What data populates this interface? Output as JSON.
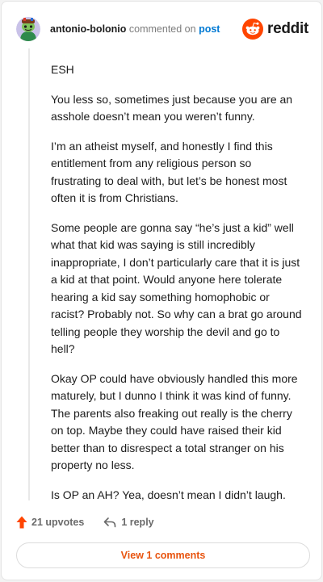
{
  "header": {
    "username": "antonio-bolonio",
    "action_text": "commented on",
    "post_link": "post",
    "brand": "reddit"
  },
  "comment": {
    "paragraphs": [
      "ESH",
      "You less so, sometimes just because you are an asshole doesn’t mean you weren’t funny.",
      "I’m an atheist myself, and honestly I find this entitlement from any religious person so frustrating to deal with, but let’s be honest most often it is from Christians.",
      "Some people are gonna say “he’s just a kid” well what that kid was saying is still incredibly inappropriate, I don’t particularly care that it is just a kid at that point. Would anyone here tolerate hearing a kid say something homophobic or racist? Probably not. So why can a brat go around telling people they worship the devil and go to hell?",
      "Okay OP could have obviously handled this more maturely, but I dunno I think it was kind of funny. The parents also freaking out really is the cherry on top. Maybe they could have raised their kid better than to disrespect a total stranger on his property no less.",
      "Is OP an AH? Yea, doesn’t mean I didn’t laugh."
    ]
  },
  "actions": {
    "upvotes": "21 upvotes",
    "replies": "1 reply"
  },
  "footer": {
    "view_button": "View 1 comments"
  },
  "colors": {
    "upvote": "#ff4500",
    "brand": "#ff4500",
    "link": "#0079d3",
    "view_button_text": "#e8540f"
  },
  "icons": {
    "avatar": "snoo-avatar-icon",
    "brand": "reddit-snoo-icon",
    "upvote": "upvote-arrow-icon",
    "reply": "reply-arrow-icon"
  }
}
